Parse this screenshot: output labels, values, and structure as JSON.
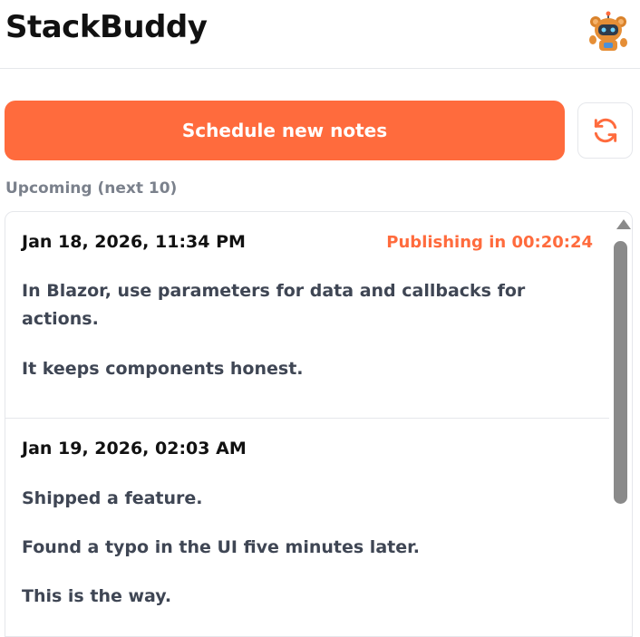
{
  "app": {
    "title": "StackBuddy",
    "accent_color": "#ff6b3d"
  },
  "header": {
    "avatar_icon": "robot-bear-mascot-icon"
  },
  "actions": {
    "schedule_label": "Schedule new notes",
    "refresh_icon": "refresh-icon"
  },
  "upcoming": {
    "label": "Upcoming (next 10)",
    "notes": [
      {
        "date": "Jan 18, 2026, 11:34 PM",
        "status": "Publishing in 00:20:24",
        "lines": [
          "In Blazor, use parameters for data and callbacks for actions.",
          "It keeps components honest."
        ]
      },
      {
        "date": "Jan 19, 2026, 02:03 AM",
        "status": "",
        "lines": [
          "Shipped a feature.",
          "Found a typo in the UI five minutes later.",
          "This is the way."
        ]
      }
    ]
  }
}
